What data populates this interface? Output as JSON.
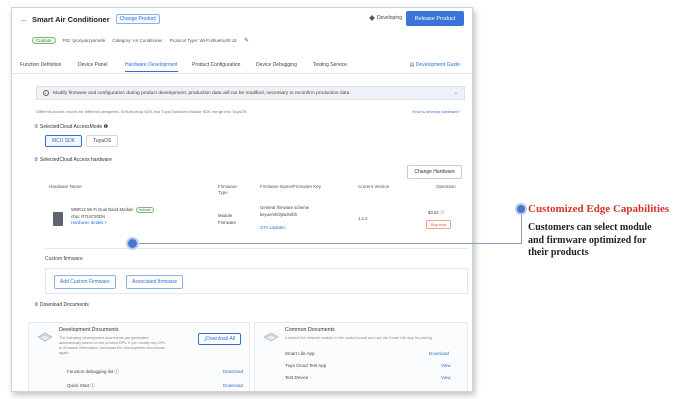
{
  "header": {
    "back": "←",
    "product_name": "Smart Air Conditioner",
    "change_product": "Change Product",
    "status": "Developing",
    "release_button": "Release Product"
  },
  "meta": {
    "tag": "Custom",
    "pid": "PID: tycxlyukzysmefe",
    "category": "Category: Air Conditioner",
    "protocol": "Protocol Type: Wi-Fi,Bluetooth LE"
  },
  "tabs": [
    "Function Definition",
    "Device Panel",
    "Hardware Development",
    "Product Configuration",
    "Device Debugging",
    "Testing Service"
  ],
  "dev_guide": "Development Guide",
  "notice": "Modify firmware and configuration during product development,  production data will not be modified,  necessary to reconfirm production data",
  "note2": "Different access modes for different categories,  Self-develop SDK and Tuya Standard Module SDK merge into TuyaOS",
  "howto": "How to develop hardware?",
  "section1": "① SelectedCloud AccessMode ❶",
  "modes": [
    "MCU SDK",
    "TuyaOS"
  ],
  "section2": "② SelectedCloud Access hardware",
  "change_hardware": "Change Hardware",
  "hw_headers": {
    "name": "Hardware Name",
    "type": "Firmware Type",
    "fw": "Firmware Name/Firmware Key",
    "version": "Current Version",
    "op": "Operation"
  },
  "hw_row": {
    "name": "WBR12 Wi-Fi Dual Band Module",
    "tag": "Hotsale",
    "chip": "chip: RTL8720DN",
    "details": "Hardware details >",
    "type_line1": "Module",
    "type_line2": "Firmware",
    "fw_name": "General firmware scheme",
    "fw_key": "keyuemhf2jtw3mbh",
    "ota": "OTA Updates",
    "version": "1.1.2",
    "price": "$3.52 ⓘ",
    "buy": "Buy now"
  },
  "custom_fw_label": "Custom firmware",
  "custom_fw_buttons": [
    "Add Custom Firmware",
    "Associated firmware"
  ],
  "section3": "③ Download Documents",
  "dev_docs": {
    "title": "Development Documents",
    "desc": "The following development documents are generated automatically based on the product DPs. If you modify any DPs or firmware information, download the development documents again.",
    "download_all": "⤓Download All",
    "rows": [
      {
        "label": "Function debugging list ⓘ",
        "action": "Download"
      },
      {
        "label": "Quick Start ⓘ",
        "action": "Download"
      }
    ]
  },
  "common_docs": {
    "title": "Common Documents",
    "desc": "Connect the network module to the control board and use the Smart Life app for pairing",
    "rows": [
      {
        "label": "Smart Life App",
        "action": "Download"
      },
      {
        "label": "Tuya Cloud Test App",
        "action": "View"
      },
      {
        "label": "Test Device",
        "action": "View"
      }
    ]
  },
  "callout": {
    "title": "Customized Edge Capabilities",
    "body": "Customers can select module and firmware optimized for their products"
  }
}
